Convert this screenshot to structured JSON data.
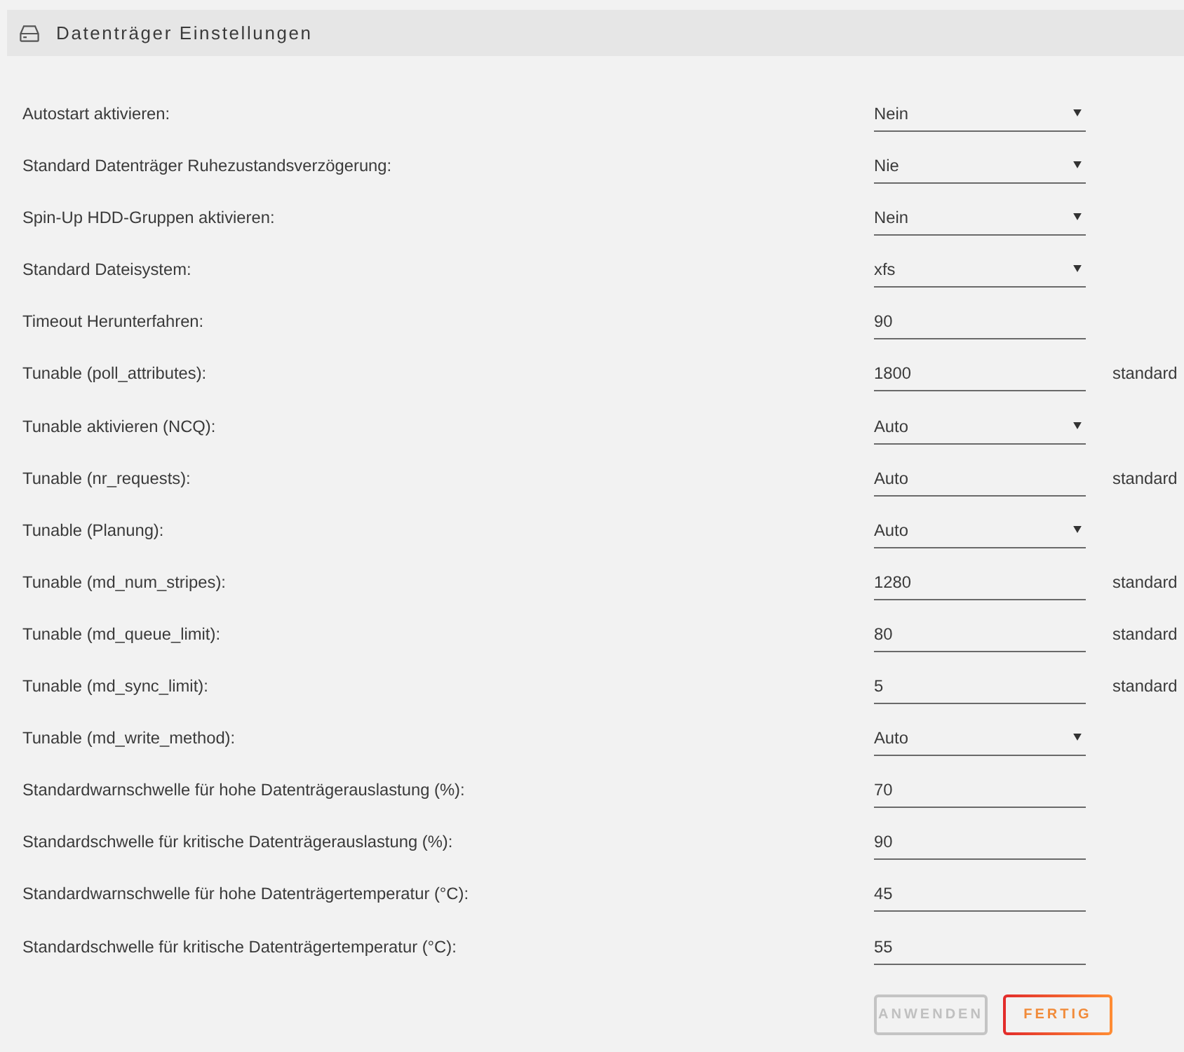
{
  "panel": {
    "title": "Datenträger Einstellungen"
  },
  "fields": [
    {
      "label": "Autostart aktivieren:",
      "kind": "select",
      "value": "Nein"
    },
    {
      "label": "Standard Datenträger Ruhezustandsverzögerung:",
      "kind": "select",
      "value": "Nie"
    },
    {
      "label": "Spin-Up HDD-Gruppen aktivieren:",
      "kind": "select",
      "value": "Nein"
    },
    {
      "label": "Standard Dateisystem:",
      "kind": "select",
      "value": "xfs"
    },
    {
      "label": "Timeout Herunterfahren:",
      "kind": "input",
      "value": "90"
    },
    {
      "label": "Tunable (poll_attributes):",
      "kind": "input",
      "value": "1800",
      "note": "standard"
    },
    {
      "label": "Tunable aktivieren (NCQ):",
      "kind": "select",
      "value": "Auto"
    },
    {
      "label": "Tunable (nr_requests):",
      "kind": "input",
      "value": "Auto",
      "note": "standard"
    },
    {
      "label": "Tunable (Planung):",
      "kind": "select",
      "value": "Auto"
    },
    {
      "label": "Tunable (md_num_stripes):",
      "kind": "input",
      "value": "1280",
      "note": "standard"
    },
    {
      "label": "Tunable (md_queue_limit):",
      "kind": "input",
      "value": "80",
      "note": "standard"
    },
    {
      "label": "Tunable (md_sync_limit):",
      "kind": "input",
      "value": "5",
      "note": "standard"
    },
    {
      "label": "Tunable (md_write_method):",
      "kind": "select",
      "value": "Auto"
    },
    {
      "label": "Standardwarnschwelle für hohe Datenträgerauslastung (%):",
      "kind": "input",
      "value": "70"
    },
    {
      "label": "Standardschwelle für kritische Datenträgerauslastung (%):",
      "kind": "input",
      "value": "90"
    },
    {
      "label": "Standardwarnschwelle für hohe Datenträgertemperatur (°C):",
      "kind": "input",
      "value": "45"
    },
    {
      "label": "Standardschwelle für kritische Datenträgertemperatur (°C):",
      "kind": "input",
      "value": "55"
    }
  ],
  "buttons": [
    {
      "label": "ANWENDEN",
      "disabled": true
    },
    {
      "label": "FERTIG",
      "disabled": false
    }
  ]
}
